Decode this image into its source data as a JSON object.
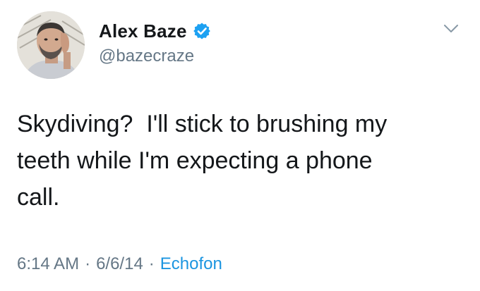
{
  "tweet": {
    "author": {
      "display_name": "Alex Baze",
      "handle": "@bazecraze",
      "verified": true
    },
    "text": "Skydiving?  I'll stick to brushing my\nteeth while I'm expecting a phone\ncall.",
    "meta": {
      "time": "6:14 AM",
      "date": "6/6/14",
      "separator": "·",
      "source": "Echofon"
    },
    "icons": {
      "verified": "verified-badge-icon",
      "menu": "chevron-down-icon"
    },
    "colors": {
      "verified": "#1da1f2",
      "link": "#1b95e0",
      "secondary_text": "#657786"
    }
  }
}
